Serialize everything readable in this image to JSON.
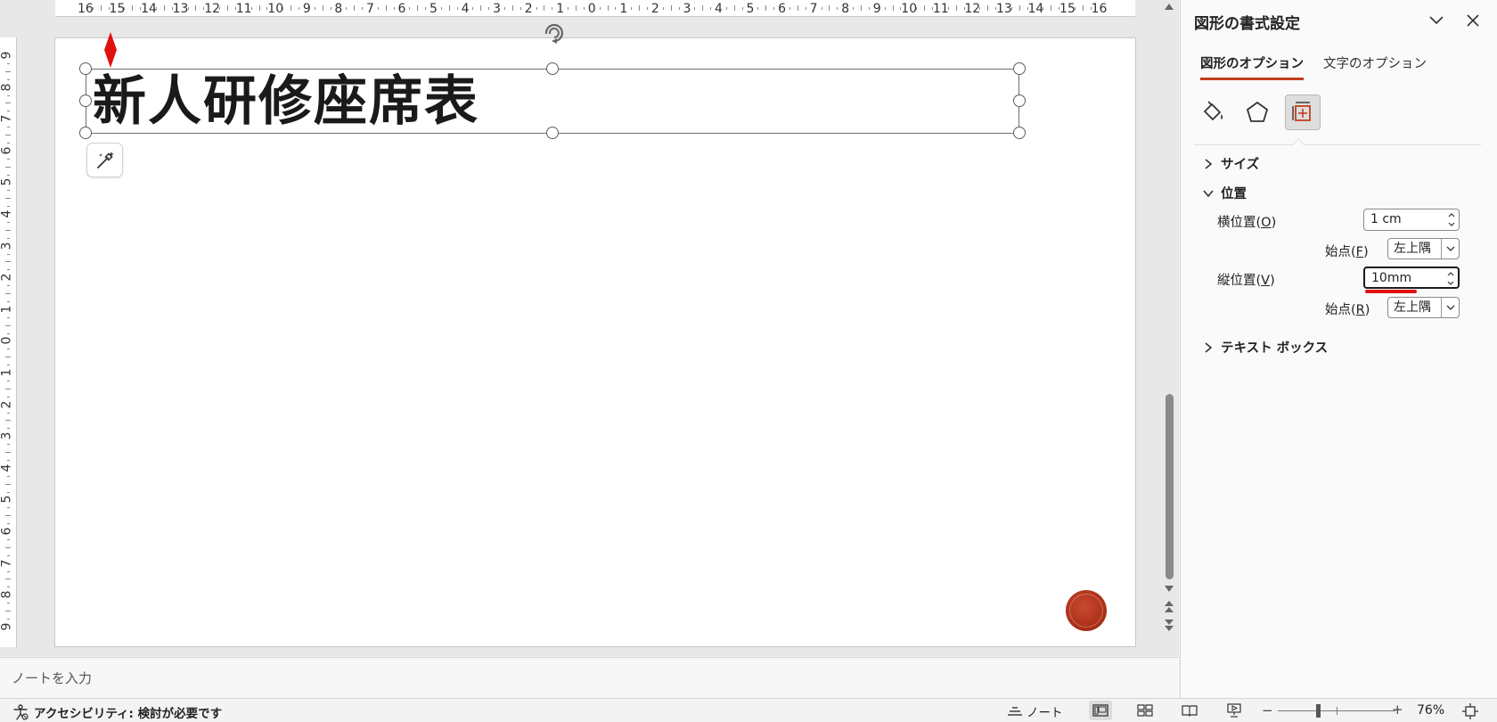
{
  "ruler": {
    "horizontal": [
      "16",
      "15",
      "14",
      "13",
      "12",
      "11",
      "10",
      "9",
      "8",
      "7",
      "6",
      "5",
      "4",
      "3",
      "2",
      "1",
      "0",
      "1",
      "2",
      "3",
      "4",
      "5",
      "6",
      "7",
      "8",
      "9",
      "10",
      "11",
      "12",
      "13",
      "14",
      "15",
      "16"
    ],
    "vertical": [
      "9",
      "8",
      "7",
      "6",
      "5",
      "4",
      "3",
      "2",
      "1",
      "0",
      "1",
      "2",
      "3",
      "4",
      "5",
      "6",
      "7",
      "8",
      "9"
    ]
  },
  "slide": {
    "title": "新人研修座席表"
  },
  "notes": {
    "placeholder": "ノートを入力"
  },
  "pane": {
    "title": "図形の書式設定",
    "tabs": {
      "shape_options": "図形のオプション",
      "text_options": "文字のオプション"
    },
    "sections": {
      "size": "サイズ",
      "position": "位置",
      "textbox": "テキスト ボックス"
    },
    "position": {
      "horizontal_label": "横位置(",
      "horizontal_key": "O",
      "horizontal_value": "1 cm",
      "h_from_label": "始点(",
      "h_from_key": "F",
      "h_from_value": "左上隅",
      "vertical_label": "縦位置(",
      "vertical_key": "V",
      "vertical_value": "10mm",
      "v_from_label": "始点(",
      "v_from_key": "R",
      "v_from_value": "左上隅",
      "close_paren": ")"
    }
  },
  "status": {
    "accessibility": "アクセシビリティ: 検討が必要です",
    "notes_button": "ノート",
    "zoom_minus": "−",
    "zoom_plus": "+",
    "zoom_level": "76%"
  },
  "colors": {
    "accent": "#c43e1c",
    "stamp": "#a82d16",
    "marker": "#e01010"
  },
  "icons": {
    "fill_line": "paint-bucket-icon",
    "effects": "pentagon-icon",
    "size_properties": "size-position-icon",
    "designer": "designer-wand-icon"
  }
}
